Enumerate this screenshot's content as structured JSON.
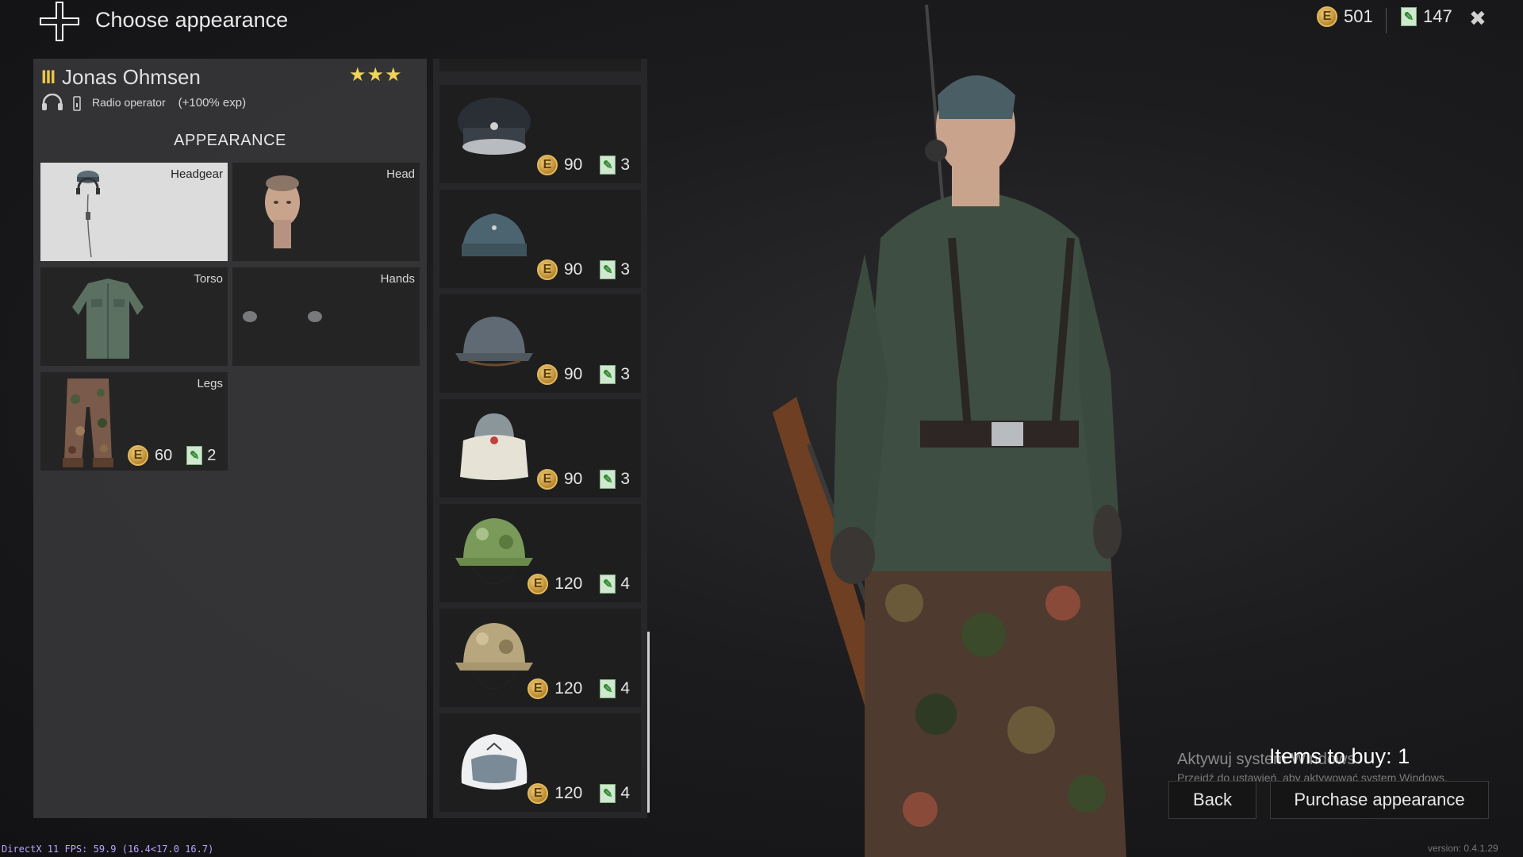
{
  "header": {
    "title": "Choose appearance",
    "faction_icon": "iron-cross-icon",
    "silver": "501",
    "tickets": "147",
    "close_icon": "close-icon"
  },
  "soldier": {
    "rank": "III",
    "name": "Jonas Ohmsen",
    "stars": "★★★",
    "role": "Radio operator",
    "bonus": "(+100% exp)"
  },
  "appearance": {
    "section_title": "APPEARANCE",
    "slots": [
      {
        "label": "Headgear",
        "selected": true
      },
      {
        "label": "Head"
      },
      {
        "label": "Torso"
      },
      {
        "label": "Hands"
      },
      {
        "label": "Legs",
        "price": "60",
        "tickets": "2"
      }
    ]
  },
  "items": [
    {
      "price": "90",
      "tickets": "3",
      "icon": "peaked-cap-icon"
    },
    {
      "price": "90",
      "tickets": "3",
      "icon": "field-cap-icon"
    },
    {
      "price": "90",
      "tickets": "3",
      "icon": "steel-helmet-icon"
    },
    {
      "price": "90",
      "tickets": "3",
      "icon": "winter-cap-icon"
    },
    {
      "price": "120",
      "tickets": "4",
      "icon": "camo-helmet-green-icon"
    },
    {
      "price": "120",
      "tickets": "4",
      "icon": "camo-helmet-tan-icon"
    },
    {
      "price": "120",
      "tickets": "4",
      "icon": "fur-hat-icon"
    }
  ],
  "currency": {
    "coin_letter": "E",
    "ticket_glyph": "✎"
  },
  "footer": {
    "items_to_buy": "Items to buy: 1",
    "back": "Back",
    "purchase": "Purchase appearance",
    "watermark_1": "Aktywuj system Windows",
    "watermark_2": "Przejdź do ustawień, aby aktywować system Windows.",
    "fps": "DirectX 11 FPS: 59.9 (16.4<17.0 16.7)",
    "version": "version: 0.4.1.29"
  },
  "colors": {
    "accent_gold": "#e9c64a",
    "panel": "#363638",
    "ticket_green": "#2f8a2f"
  }
}
